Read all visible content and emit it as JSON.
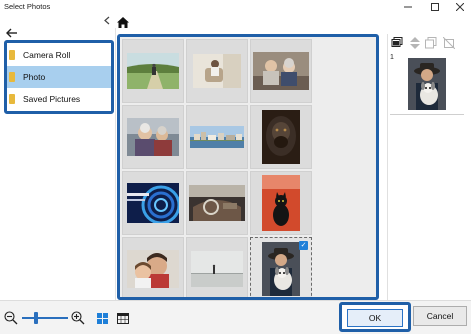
{
  "window": {
    "title": "Select Photos",
    "controls": [
      "minimize-icon",
      "maximize-icon",
      "close-icon"
    ]
  },
  "nav": {
    "back_icon": "arrow-left-icon",
    "collapse_icon": "chevron-left-icon",
    "home_icon": "home-icon"
  },
  "folders": [
    {
      "label": "Camera Roll",
      "selected": false
    },
    {
      "label": "Photo",
      "selected": true
    },
    {
      "label": "Saved Pictures",
      "selected": false
    }
  ],
  "photos": [
    {
      "subject": "woman walking on rural path",
      "selected": false
    },
    {
      "subject": "woman reading in chair",
      "selected": false
    },
    {
      "subject": "elderly couple on sofa",
      "selected": false
    },
    {
      "subject": "elderly couple smiling",
      "selected": false
    },
    {
      "subject": "coastal cityscape",
      "selected": false
    },
    {
      "subject": "gorilla portrait",
      "selected": false
    },
    {
      "subject": "blue abstract rings",
      "selected": false
    },
    {
      "subject": "vintage car interior",
      "selected": false
    },
    {
      "subject": "black cat on red background",
      "selected": false
    },
    {
      "subject": "father and child",
      "selected": false
    },
    {
      "subject": "person on hazy beach",
      "selected": false
    },
    {
      "subject": "man with dog in hat",
      "selected": true
    }
  ],
  "selection_panel": {
    "tools": [
      "stack-icon",
      "move-up-icon",
      "copy-icon",
      "deselect-icon"
    ],
    "items": [
      {
        "index": "1",
        "subject": "man with dog in hat"
      }
    ]
  },
  "bottom": {
    "zoom": {
      "level": 0.3
    },
    "view_icons": [
      "grid-view-icon",
      "calendar-view-icon"
    ],
    "ok_label": "OK",
    "cancel_label": "Cancel"
  },
  "colors": {
    "accent": "#1f5fa8",
    "selected_folder": "#a8cfee",
    "checkmark": "#1e7fd8"
  }
}
